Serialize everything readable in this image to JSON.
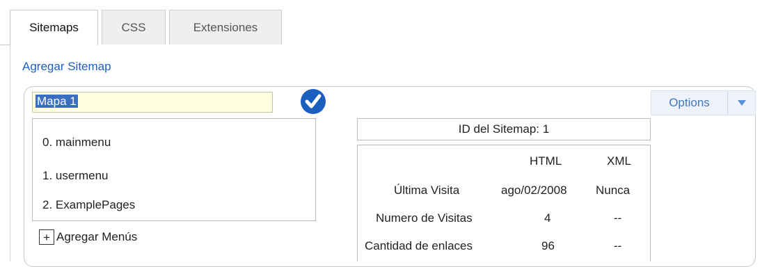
{
  "tabs": [
    {
      "label": "Sitemaps",
      "active": true
    },
    {
      "label": "CSS",
      "active": false
    },
    {
      "label": "Extensiones",
      "active": false
    }
  ],
  "add_sitemap_link": "Agregar Sitemap",
  "sitemap": {
    "name_value": "Mapa 1",
    "options_label": "Options",
    "menus": [
      "0. mainmenu",
      "1. usermenu",
      "2. ExamplePages"
    ],
    "add_menus_label": "Agregar Menús",
    "id_text": "ID del Sitemap: 1",
    "stats": {
      "col_html": "HTML",
      "col_xml": "XML",
      "rows": [
        {
          "label": "Última Visita",
          "html": "ago/02/2008",
          "xml": "Nunca"
        },
        {
          "label": "Numero de Visitas",
          "html": "4",
          "xml": "--"
        },
        {
          "label": "Cantidad de enlaces",
          "html": "96",
          "xml": "--"
        }
      ]
    }
  },
  "colors": {
    "link": "#1f5fbf",
    "check": "#1a5fc0",
    "input_bg": "#fdfde0",
    "selection": "#3a6ec0"
  }
}
